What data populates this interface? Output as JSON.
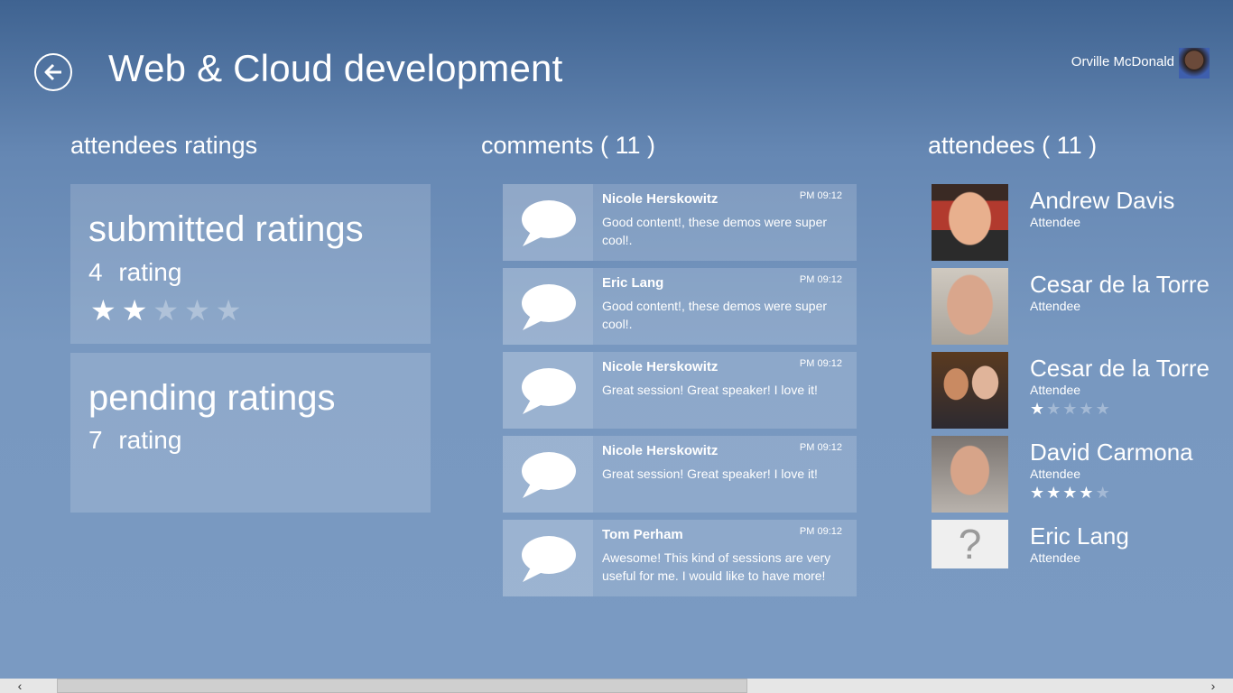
{
  "header": {
    "title": "Web & Cloud development",
    "user_name": "Orville McDonald"
  },
  "ratings": {
    "title": "attendees ratings",
    "submitted": {
      "title": "submitted ratings",
      "count": "4",
      "unit": "rating",
      "stars": 2,
      "max_stars": 5
    },
    "pending": {
      "title": "pending ratings",
      "count": "7",
      "unit": "rating"
    }
  },
  "comments": {
    "title": "comments ( 11 )",
    "items": [
      {
        "author": "Nicole Herskowitz",
        "time": "PM 09:12",
        "text": "Good content!, these demos were super cool!."
      },
      {
        "author": "Eric Lang",
        "time": "PM 09:12",
        "text": "Good content!, these demos were super cool!."
      },
      {
        "author": "Nicole Herskowitz",
        "time": "PM 09:12",
        "text": "Great session! Great speaker! I love it!"
      },
      {
        "author": "Nicole Herskowitz",
        "time": "PM 09:12",
        "text": "Great session! Great speaker! I love it!"
      },
      {
        "author": "Tom Perham",
        "time": "PM 09:12",
        "text": "Awesome! This kind of sessions are very useful for me. I would like to have more!"
      }
    ]
  },
  "attendees": {
    "title": "attendees ( 11 )",
    "items": [
      {
        "name": "Andrew Davis",
        "role": "Attendee",
        "stars": 0
      },
      {
        "name": "Cesar de la Torre",
        "role": "Attendee",
        "stars": 0
      },
      {
        "name": "Cesar de la Torre",
        "role": "Attendee",
        "stars": 1
      },
      {
        "name": "David Carmona",
        "role": "Attendee",
        "stars": 4
      },
      {
        "name": "Eric Lang",
        "role": "Attendee",
        "stars": 0
      }
    ]
  },
  "scrollbar": {
    "position_fraction": 0.05,
    "visible_fraction": 0.56
  }
}
